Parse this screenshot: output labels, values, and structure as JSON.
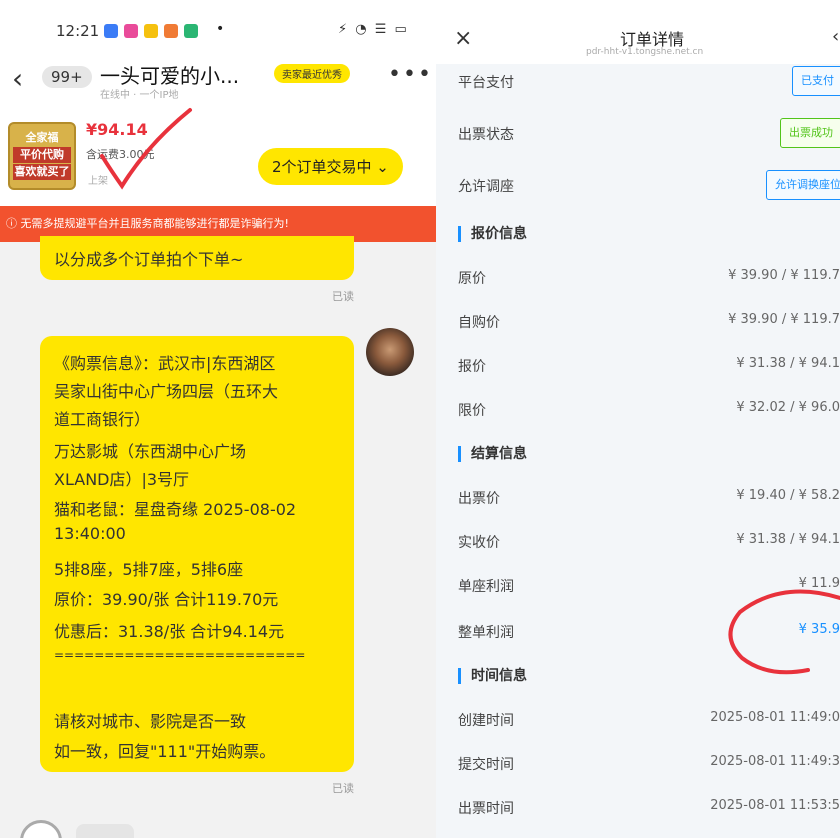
{
  "status_bar": {
    "time": "12:21",
    "dot": "•",
    "system": "⚡ ◔ ☰ ▭"
  },
  "chat": {
    "back_label": "‹",
    "unread_badge": "99+",
    "title": "一头可爱的小...",
    "subtitle": "在线中 · 一个IP地",
    "seller_tag": "卖家最近优秀",
    "more_label": "•••"
  },
  "product": {
    "thumb_lines": [
      "全家福",
      "平价代购",
      "喜欢就买了"
    ],
    "price": "¥94.14",
    "fee": "含运费3.00元",
    "tag": "上架",
    "order_button": "2个订单交易中 ⌄"
  },
  "warning_banner": "ⓘ 无需多提规避平台并且服务商都能够进行都是诈骗行为!",
  "messages": [
    {
      "text": "以分成多个订单拍个下单~",
      "read": "已读"
    },
    {
      "lines": [
        "《购票信息》：武汉市|东西湖区",
        "吴家山街中心广场四层（五环大",
        "道工商银行）",
        "万达影城（东西湖中心广场",
        "XLAND店）|3号厅",
        "猫和老鼠：星盘奇缘  2025-08-02",
        "13:40:00",
        "5排8座，5排7座，5排6座",
        "原价：39.90/张  合计119.70元",
        "优惠后：31.38/张  合计94.14元",
        "=========================",
        "",
        "请核对城市、影院是否一致",
        "如一致，回复\"111\"开始购票。"
      ],
      "read": "已读"
    }
  ],
  "order_detail": {
    "close_label": "×",
    "title": "订单详情",
    "subtitle": "pdr-hht-v1.tongshe.net.cn",
    "arrow_label": "‹",
    "rows_top": [
      {
        "label": "平台支付",
        "badge": "已支付"
      },
      {
        "label": "出票状态",
        "badge": "出票成功"
      },
      {
        "label": "允许调座",
        "badge": "允许调换座位"
      }
    ],
    "section_pricing": "报价信息",
    "pricing_rows": [
      {
        "label": "原价",
        "value": "¥ 39.90 / ¥ 119.7"
      },
      {
        "label": "自购价",
        "value": "¥ 39.90 / ¥ 119.7"
      },
      {
        "label": "报价",
        "value": "¥ 31.38 / ¥ 94.1"
      },
      {
        "label": "限价",
        "value": "¥ 32.02 / ¥ 96.0"
      }
    ],
    "section_settle": "结算信息",
    "settle_rows": [
      {
        "label": "出票价",
        "value": "¥ 19.40 / ¥ 58.2"
      },
      {
        "label": "实收价",
        "value": "¥ 31.38 / ¥ 94.1"
      },
      {
        "label": "单座利润",
        "value": "¥ 11.9"
      },
      {
        "label": "整单利润",
        "value": "¥ 35.9"
      }
    ],
    "section_time": "时间信息",
    "time_rows": [
      {
        "label": "创建时间",
        "value": "2025-08-01 11:49:0"
      },
      {
        "label": "提交时间",
        "value": "2025-08-01 11:49:3"
      },
      {
        "label": "出票时间",
        "value": "2025-08-01 11:53:5"
      }
    ]
  },
  "colors": {
    "accent_yellow": "#ffe600",
    "warning_red": "#f2522e",
    "price_red": "#e8323c",
    "link_blue": "#1890ff",
    "annotation_red": "#e8323c"
  }
}
